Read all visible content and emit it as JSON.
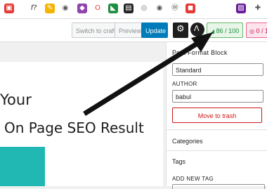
{
  "bookmarks": {
    "icons": [
      "pdf-icon",
      "function-icon",
      "pen-icon",
      "camera-icon",
      "purple-icon",
      "opera-icon",
      "seo-icon",
      "film-icon",
      "gray-icon",
      "red-icon",
      "wordpress-icon",
      "drive-icon",
      "hx-icon",
      "extensions-icon"
    ],
    "fn_label": "f?"
  },
  "toolbar": {
    "switch_label": "Switch to craft",
    "preview_label": "Preview",
    "update_label": "Update",
    "score_label": "86 / 100",
    "readability_label": "0 / 1"
  },
  "canvas": {
    "heading_partial": "Your",
    "heading_main": "On Page SEO Result"
  },
  "sidebar": {
    "format_label": "Post Format Block",
    "format_value": "Standard",
    "author_label": "AUTHOR",
    "author_value": "babul",
    "trash_label": "Move to trash",
    "categories_label": "Categories",
    "tags_label": "Tags",
    "add_tag_label": "ADD NEW TAG"
  },
  "colors": {
    "accent": "#007cba",
    "teal": "#21b7b3",
    "danger": "#cc1818",
    "score_green": "#1e8e3e"
  }
}
